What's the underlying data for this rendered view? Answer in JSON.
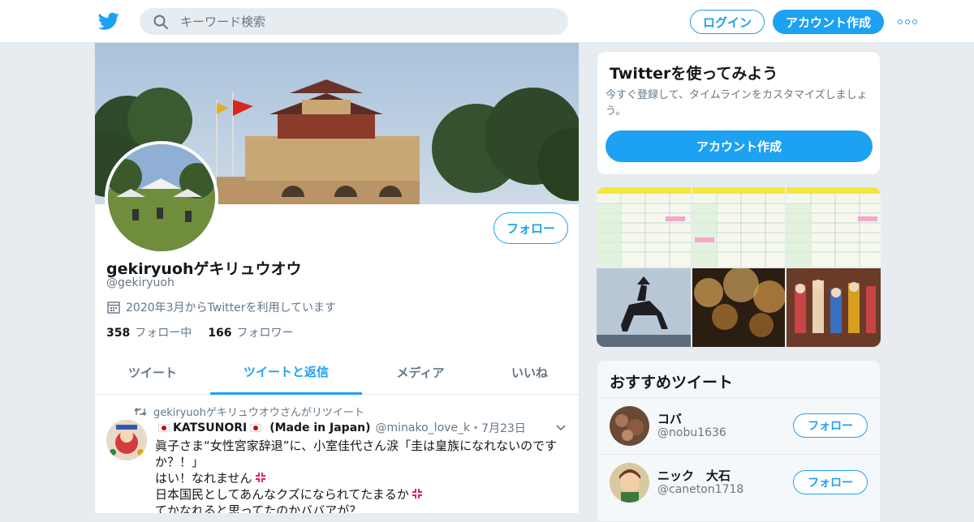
{
  "header": {
    "search_placeholder": "キーワード検索",
    "login_label": "ログイン",
    "signup_label": "アカウント作成"
  },
  "profile": {
    "name": "gekiryuohゲキリュウオウ",
    "handle": "@gekiryuoh",
    "joined": "2020年3月からTwitterを利用しています",
    "following_count": "358",
    "following_label": "フォロー中",
    "followers_count": "166",
    "followers_label": "フォロワー",
    "follow_label": "フォロー"
  },
  "tabs": [
    {
      "label": "ツイート",
      "active": false
    },
    {
      "label": "ツイートと返信",
      "active": true
    },
    {
      "label": "メディア",
      "active": false
    },
    {
      "label": "いいね",
      "active": false
    }
  ],
  "tweet": {
    "retweet_text": "gekiryuohゲキリュウオウさんがリツイート",
    "author_name_a": "KATSUNORI",
    "author_name_b": "(Made in Japan)",
    "author_handle": "@minako_love_k",
    "date": "・7月23日",
    "lines": [
      "眞子さま“女性宮家辞退”に、小室佳代さん涙「圭は皇族になれないのですか？！」",
      "はい！なれません",
      "日本国民としてあんなクズになられてたまるか",
      "てかなれると思ってたのかババアが？"
    ]
  },
  "sidebar": {
    "card_title": "Twitterを使ってみよう",
    "card_desc": "今すぐ登録して、タイムラインをカスタマイズしましょう。",
    "card_button": "アカウント作成",
    "reco_title": "おすすめツイート",
    "reco": [
      {
        "name": "コバ",
        "handle": "@nobu1636",
        "button": "フォロー"
      },
      {
        "name": "ニック　大石",
        "handle": "@caneton1718",
        "button": "フォロー"
      }
    ]
  },
  "colors": {
    "accent": "#1da1f2",
    "muted": "#657786",
    "text": "#14171a",
    "background": "#e6ecf0"
  },
  "icons": [
    "twitter-bird-icon",
    "search-icon",
    "more-dots-icon",
    "calendar-icon",
    "retweet-icon",
    "chevron-down-icon",
    "anger-emoji-icon"
  ]
}
